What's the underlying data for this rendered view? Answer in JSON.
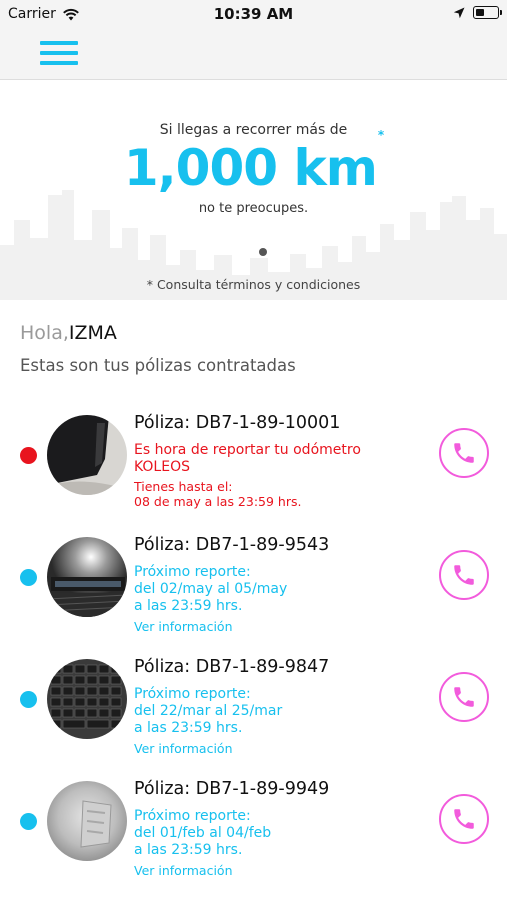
{
  "status_bar": {
    "carrier": "Carrier",
    "time": "10:39 AM"
  },
  "nav": {
    "menu_icon": "hamburger-menu-icon"
  },
  "banner": {
    "line1": "Si llegas a recorrer más de",
    "big_value": "1,000 km",
    "asterisk": "*",
    "line3": "no te preocupes.",
    "terms": "* Consulta términos y condiciones"
  },
  "greeting": {
    "hello": "Hola,",
    "name": "IZMA",
    "subtitle": "Estas son tus pólizas contratadas"
  },
  "colors": {
    "accent": "#17c0ee",
    "alert": "#e8141e",
    "call": "#f25bdc"
  },
  "policies": [
    {
      "title": "Póliza: DB7-1-89-10001",
      "status": "alert",
      "line1": "Es hora de reportar tu odómetro",
      "line2": "KOLEOS",
      "small1": "Tienes hasta el:",
      "small2": "08 de may a las 23:59 hrs."
    },
    {
      "title": "Póliza: DB7-1-89-9543",
      "status": "ok",
      "line1": "Próximo reporte:",
      "line2": "del 02/may al 05/may",
      "line3": "a las 23:59 hrs.",
      "link": "Ver información"
    },
    {
      "title": "Póliza: DB7-1-89-9847",
      "status": "ok",
      "line1": "Próximo reporte:",
      "line2": "del 22/mar al 25/mar",
      "line3": "a las 23:59 hrs.",
      "link": "Ver información"
    },
    {
      "title": "Póliza: DB7-1-89-9949",
      "status": "ok",
      "line1": "Próximo reporte:",
      "line2": "del 01/feb al 04/feb",
      "line3": "a las 23:59 hrs.",
      "link": "Ver información"
    }
  ]
}
